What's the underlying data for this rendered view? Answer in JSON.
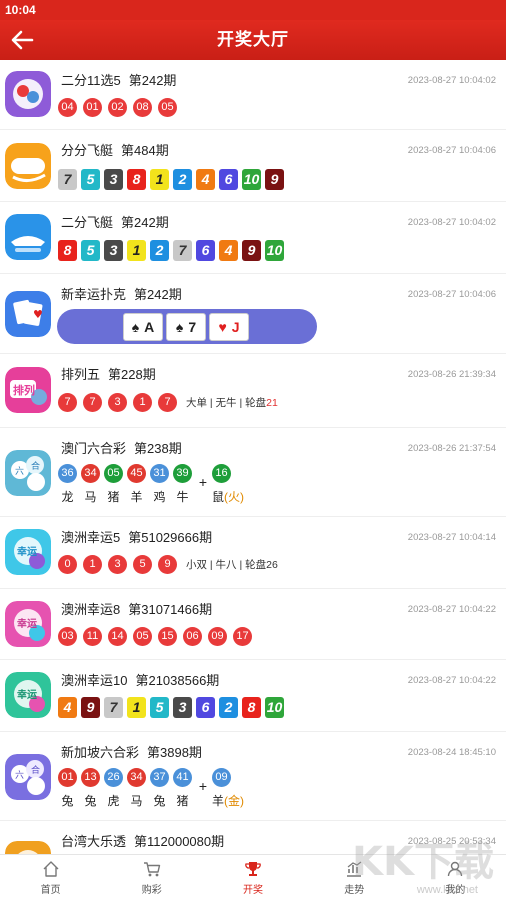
{
  "status": {
    "time": "10:04"
  },
  "header": {
    "title": "开奖大厅",
    "back_icon": "back-arrow-icon"
  },
  "colors": {
    "red": "#e83a3a",
    "brand": "#d9261c",
    "mark_blue": "#4a90d9",
    "mark_red": "#e0392f",
    "mark_green": "#1e9e3a"
  },
  "rows": [
    {
      "name": "二分11选5",
      "issue": "第242期",
      "date": "2023-08-27 10:04:02",
      "balls": [
        "04",
        "01",
        "02",
        "08",
        "05"
      ]
    },
    {
      "name": "分分飞艇",
      "issue": "第484期",
      "date": "2023-08-27 10:04:06",
      "squares": [
        "7",
        "5",
        "3",
        "8",
        "1",
        "2",
        "4",
        "6",
        "10",
        "9"
      ]
    },
    {
      "name": "二分飞艇",
      "issue": "第242期",
      "date": "2023-08-27 10:04:02",
      "squares": [
        "8",
        "5",
        "3",
        "1",
        "2",
        "7",
        "6",
        "4",
        "9",
        "10"
      ]
    },
    {
      "name": "新幸运扑克",
      "issue": "第242期",
      "date": "2023-08-27 10:04:06",
      "cards": [
        {
          "suit": "♠",
          "rank": "A"
        },
        {
          "suit": "♠",
          "rank": "7"
        },
        {
          "suit": "♥",
          "rank": "J"
        }
      ]
    },
    {
      "name": "排列五",
      "issue": "第228期",
      "date": "2023-08-26 21:39:34",
      "balls": [
        "7",
        "7",
        "3",
        "1",
        "7"
      ],
      "extra_a": "大单 | 无牛 | 轮盘",
      "extra_b": "21"
    },
    {
      "name": "澳门六合彩",
      "issue": "第238期",
      "date": "2023-08-26 21:37:54",
      "marks": [
        {
          "n": "36",
          "z": "龙"
        },
        {
          "n": "34",
          "z": "马"
        },
        {
          "n": "05",
          "z": "猪"
        },
        {
          "n": "45",
          "z": "羊"
        },
        {
          "n": "31",
          "z": "鸡"
        },
        {
          "n": "39",
          "z": "牛"
        }
      ],
      "special": {
        "n": "16",
        "z": "鼠",
        "el": "(火)"
      }
    },
    {
      "name": "澳洲幸运5",
      "issue": "第51029666期",
      "date": "2023-08-27 10:04:14",
      "balls": [
        "0",
        "1",
        "3",
        "5",
        "9"
      ],
      "extra_a": "小双 | 牛八 | 轮盘",
      "extra_b": "26"
    },
    {
      "name": "澳洲幸运8",
      "issue": "第31071466期",
      "date": "2023-08-27 10:04:22",
      "balls": [
        "03",
        "11",
        "14",
        "05",
        "15",
        "06",
        "09",
        "17"
      ]
    },
    {
      "name": "澳洲幸运10",
      "issue": "第21038566期",
      "date": "2023-08-27 10:04:22",
      "squares": [
        "4",
        "9",
        "7",
        "1",
        "5",
        "3",
        "6",
        "2",
        "8",
        "10"
      ]
    },
    {
      "name": "新加坡六合彩",
      "issue": "第3898期",
      "date": "2023-08-24 18:45:10",
      "marks": [
        {
          "n": "01",
          "z": "兔"
        },
        {
          "n": "13",
          "z": "兔"
        },
        {
          "n": "26",
          "z": "虎"
        },
        {
          "n": "34",
          "z": "马"
        },
        {
          "n": "37",
          "z": "兔"
        },
        {
          "n": "41",
          "z": "猪"
        }
      ],
      "special": {
        "n": "09",
        "z": "羊",
        "el": "(金)"
      }
    },
    {
      "name": "台湾大乐透",
      "issue": "第112000080期",
      "date": "2023-08-25 20:53:34"
    }
  ],
  "tabs": [
    {
      "label": "首页",
      "icon": "home-icon"
    },
    {
      "label": "购彩",
      "icon": "cart-icon"
    },
    {
      "label": "开奖",
      "icon": "trophy-icon"
    },
    {
      "label": "走势",
      "icon": "chart-icon"
    },
    {
      "label": "我的",
      "icon": "user-icon"
    }
  ],
  "watermark": {
    "big": "KK下载",
    "small": "www.kkx.net"
  }
}
